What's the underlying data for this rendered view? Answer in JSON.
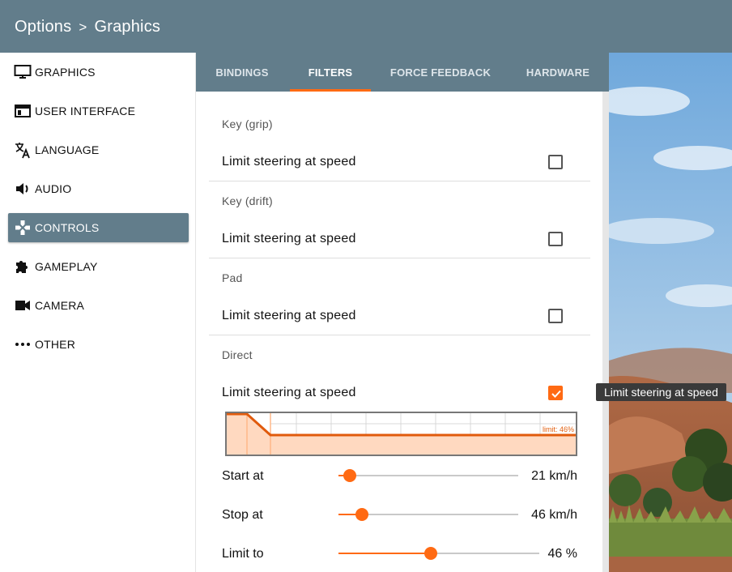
{
  "header": {
    "crumb_root": "Options",
    "separator": ">",
    "crumb_current": "Graphics"
  },
  "sidebar": {
    "items": [
      {
        "label": "GRAPHICS",
        "icon": "monitor-icon"
      },
      {
        "label": "USER INTERFACE",
        "icon": "window-icon"
      },
      {
        "label": "LANGUAGE",
        "icon": "translate-icon"
      },
      {
        "label": "AUDIO",
        "icon": "speaker-icon"
      },
      {
        "label": "CONTROLS",
        "icon": "gamepad-icon",
        "active": true
      },
      {
        "label": "GAMEPLAY",
        "icon": "puzzle-icon"
      },
      {
        "label": "CAMERA",
        "icon": "videocam-icon"
      },
      {
        "label": "OTHER",
        "icon": "more-dots-icon"
      }
    ]
  },
  "tabs": [
    {
      "label": "BINDINGS"
    },
    {
      "label": "FILTERS",
      "active": true
    },
    {
      "label": "FORCE FEEDBACK"
    },
    {
      "label": "HARDWARE"
    }
  ],
  "filters": {
    "sections": [
      {
        "title": "Key (grip)",
        "option": "Limit steering at speed",
        "checked": false
      },
      {
        "title": "Key (drift)",
        "option": "Limit steering at speed",
        "checked": false
      },
      {
        "title": "Pad",
        "option": "Limit steering at speed",
        "checked": false
      },
      {
        "title": "Direct",
        "option": "Limit steering at speed",
        "checked": true
      }
    ],
    "graph_label": "limit: 46%",
    "sliders": [
      {
        "label": "Start at",
        "value": "21 km/h",
        "fraction": 0.06
      },
      {
        "label": "Stop at",
        "value": "46 km/h",
        "fraction": 0.13
      },
      {
        "label": "Limit to",
        "value": "46 %",
        "fraction": 0.46
      }
    ]
  },
  "tooltip": {
    "text": "Limit steering at speed"
  },
  "colors": {
    "header": "#627d8b",
    "accent": "#ff6a13",
    "graph_fill": "#ffd9c0"
  }
}
